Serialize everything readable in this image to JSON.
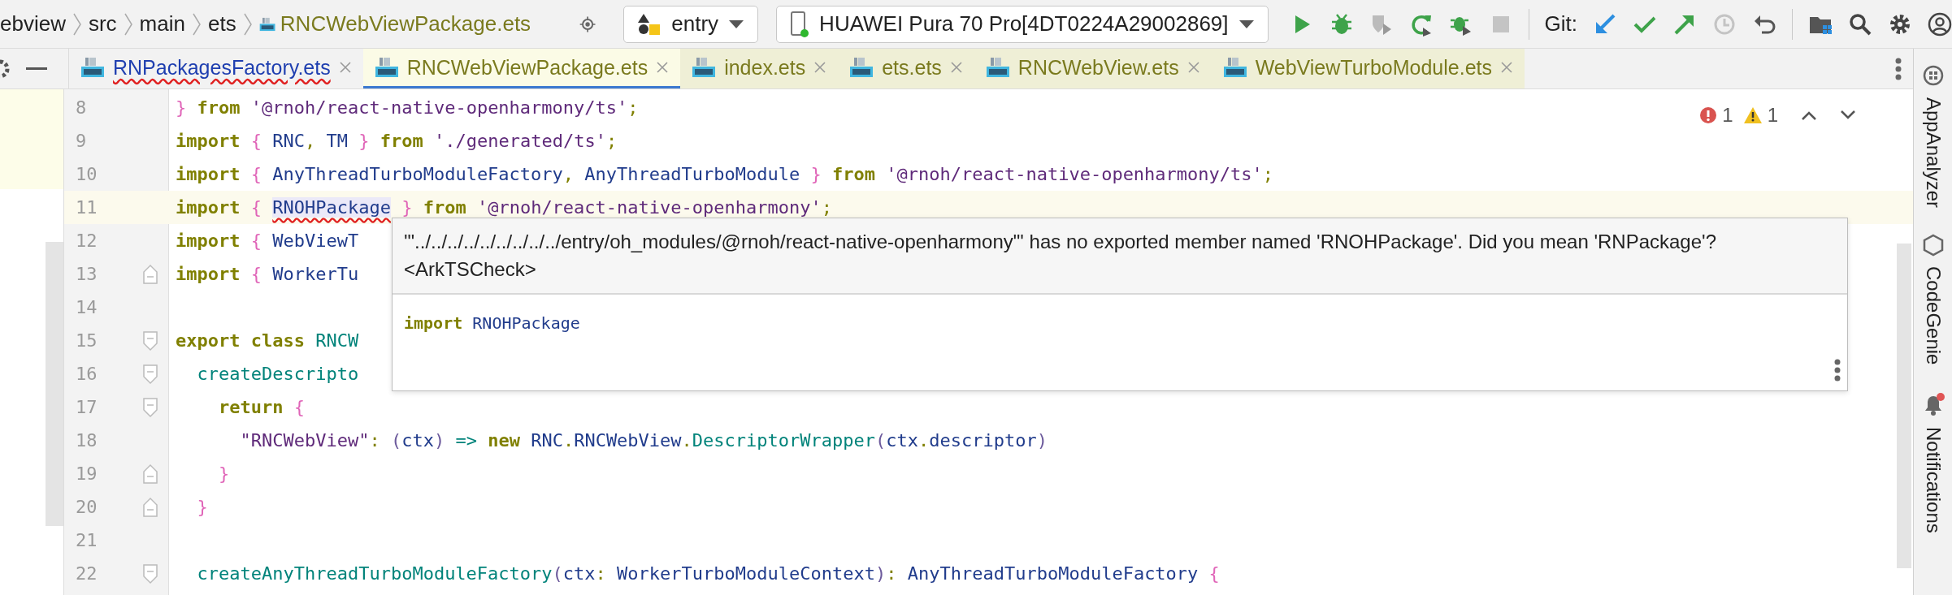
{
  "toolbar": {
    "breadcrumbs": [
      "ebview",
      "src",
      "main",
      "ets"
    ],
    "file": "RNCWebViewPackage.ets",
    "run_config": "entry",
    "device": "HUAWEI Pura 70 Pro[4DT0224A29002869]",
    "git_label": "Git:"
  },
  "tabs": [
    {
      "label": "RNPackagesFactory.ets",
      "selected": false,
      "has_error": true,
      "highlighted": false
    },
    {
      "label": "RNCWebViewPackage.ets",
      "selected": true,
      "has_error": false,
      "highlighted": true
    },
    {
      "label": "index.ets",
      "selected": false,
      "has_error": false,
      "highlighted": true
    },
    {
      "label": "ets.ets",
      "selected": false,
      "has_error": false,
      "highlighted": true
    },
    {
      "label": "RNCWebView.ets",
      "selected": false,
      "has_error": false,
      "highlighted": true
    },
    {
      "label": "WebViewTurboModule.ets",
      "selected": false,
      "has_error": false,
      "highlighted": true
    }
  ],
  "problems": {
    "errors": "1",
    "warnings": "1"
  },
  "code_lines": [
    {
      "number": "8",
      "current": false,
      "fold_start": false,
      "fold_end": false,
      "tokens": [
        {
          "kind": "brace",
          "text": "}"
        },
        {
          "kind": "kw",
          "text": " from "
        },
        {
          "kind": "str",
          "text": "'@rnoh/react-native-openharmony/ts'"
        },
        {
          "kind": "punct",
          "text": ";"
        }
      ]
    },
    {
      "number": "9",
      "current": false,
      "fold_start": false,
      "fold_end": false,
      "tokens": [
        {
          "kind": "kw",
          "text": "import "
        },
        {
          "kind": "brace",
          "text": "{ "
        },
        {
          "kind": "ident",
          "text": "RNC"
        },
        {
          "kind": "punct",
          "text": ", "
        },
        {
          "kind": "ident",
          "text": "TM "
        },
        {
          "kind": "brace",
          "text": "}"
        },
        {
          "kind": "kw",
          "text": " from "
        },
        {
          "kind": "str",
          "text": "'./generated/ts'"
        },
        {
          "kind": "punct",
          "text": ";"
        }
      ]
    },
    {
      "number": "10",
      "current": false,
      "fold_start": false,
      "fold_end": false,
      "tokens": [
        {
          "kind": "kw",
          "text": "import "
        },
        {
          "kind": "brace",
          "text": "{ "
        },
        {
          "kind": "ident",
          "text": "AnyThreadTurboModuleFactory"
        },
        {
          "kind": "punct",
          "text": ", "
        },
        {
          "kind": "ident",
          "text": "AnyThreadTurboModule "
        },
        {
          "kind": "brace",
          "text": "}"
        },
        {
          "kind": "kw",
          "text": " from "
        },
        {
          "kind": "str",
          "text": "'@rnoh/react-native-openharmony/ts'"
        },
        {
          "kind": "punct",
          "text": ";"
        }
      ]
    },
    {
      "number": "11",
      "current": true,
      "fold_start": false,
      "fold_end": false,
      "tokens": [
        {
          "kind": "kw",
          "text": "import "
        },
        {
          "kind": "brace",
          "text": "{ "
        },
        {
          "kind": "error",
          "text": "RNOHPackage"
        },
        {
          "kind": "brace",
          "text": " }"
        },
        {
          "kind": "kw",
          "text": " from "
        },
        {
          "kind": "str",
          "text": "'@rnoh/react-native-openharmony'"
        },
        {
          "kind": "punct",
          "text": ";"
        }
      ]
    },
    {
      "number": "12",
      "current": false,
      "fold_start": false,
      "fold_end": false,
      "tokens": [
        {
          "kind": "kw",
          "text": "import "
        },
        {
          "kind": "brace",
          "text": "{ "
        },
        {
          "kind": "ident",
          "text": "WebViewT"
        }
      ]
    },
    {
      "number": "13",
      "current": false,
      "fold_start": false,
      "fold_end": true,
      "tokens": [
        {
          "kind": "kw",
          "text": "import "
        },
        {
          "kind": "brace",
          "text": "{ "
        },
        {
          "kind": "ident",
          "text": "WorkerTu"
        }
      ]
    },
    {
      "number": "14",
      "current": false,
      "fold_start": false,
      "fold_end": false
    },
    {
      "number": "15",
      "current": false,
      "fold_start": true,
      "fold_end": false,
      "tokens": [
        {
          "kind": "kw",
          "text": "export class "
        },
        {
          "kind": "fn",
          "text": "RNCW"
        }
      ]
    },
    {
      "number": "16",
      "current": false,
      "fold_start": true,
      "fold_end": false,
      "tokens": [
        {
          "kind": "fn",
          "text": "  createDescripto"
        }
      ]
    },
    {
      "number": "17",
      "current": false,
      "fold_start": true,
      "fold_end": false,
      "tokens": [
        {
          "kind": "kw",
          "text": "    return "
        },
        {
          "kind": "brace",
          "text": "{"
        }
      ]
    },
    {
      "number": "18",
      "current": false,
      "fold_start": false,
      "fold_end": false,
      "tokens": [
        {
          "kind": "str",
          "text": "      \"RNCWebView\""
        },
        {
          "kind": "punct",
          "text": ": "
        },
        {
          "kind": "paren",
          "text": "("
        },
        {
          "kind": "ident",
          "text": "ctx"
        },
        {
          "kind": "paren",
          "text": ")"
        },
        {
          "kind": "op",
          "text": " => "
        },
        {
          "kind": "kw",
          "text": "new "
        },
        {
          "kind": "ident",
          "text": "RNC"
        },
        {
          "kind": "punct",
          "text": "."
        },
        {
          "kind": "ident",
          "text": "RNCWebView"
        },
        {
          "kind": "punct",
          "text": "."
        },
        {
          "kind": "fn",
          "text": "DescriptorWrapper"
        },
        {
          "kind": "paren",
          "text": "("
        },
        {
          "kind": "ident",
          "text": "ctx"
        },
        {
          "kind": "punct",
          "text": "."
        },
        {
          "kind": "ident",
          "text": "descriptor"
        },
        {
          "kind": "paren",
          "text": ")"
        }
      ]
    },
    {
      "number": "19",
      "current": false,
      "fold_start": false,
      "fold_end": true,
      "tokens": [
        {
          "kind": "brace",
          "text": "    }"
        }
      ]
    },
    {
      "number": "20",
      "current": false,
      "fold_start": false,
      "fold_end": true,
      "tokens": [
        {
          "kind": "brace",
          "text": "  }"
        }
      ]
    },
    {
      "number": "21",
      "current": false,
      "fold_start": false,
      "fold_end": false
    },
    {
      "number": "22",
      "current": false,
      "fold_start": true,
      "fold_end": false,
      "tokens": [
        {
          "kind": "fn",
          "text": "  createAnyThreadTurboModuleFactory"
        },
        {
          "kind": "paren",
          "text": "("
        },
        {
          "kind": "ident",
          "text": "ctx"
        },
        {
          "kind": "punct",
          "text": ": "
        },
        {
          "kind": "ident",
          "text": "WorkerTurboModuleContext"
        },
        {
          "kind": "paren",
          "text": ")"
        },
        {
          "kind": "punct",
          "text": ": "
        },
        {
          "kind": "ident",
          "text": "AnyThreadTurboModuleFactory "
        },
        {
          "kind": "brace",
          "text": "{"
        }
      ]
    }
  ],
  "tooltip": {
    "message": "'\"../../../../../../../../../entry/oh_modules/@rnoh/react-native-openharmony\"' has no exported member named 'RNOHPackage'. Did you mean 'RNPackage'?",
    "source": "<ArkTSCheck>",
    "fix_keyword": "import",
    "fix_name": "RNOHPackage"
  },
  "tool_strip": [
    "AppAnalyzer",
    "CodeGenie",
    "Notifications"
  ]
}
